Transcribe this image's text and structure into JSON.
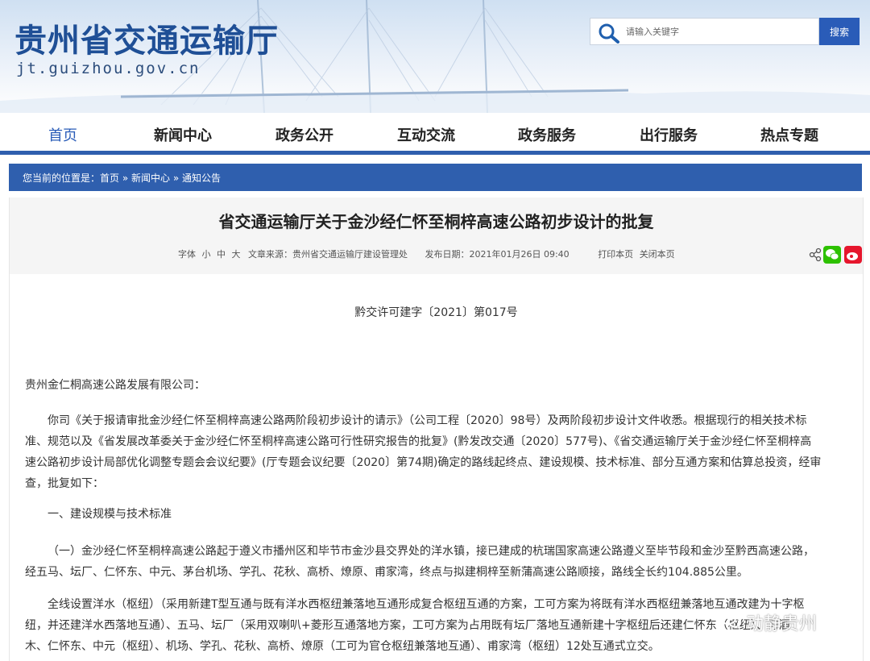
{
  "site": {
    "title": "贵州省交通运输厅",
    "url": "jt.guizhou.gov.cn"
  },
  "search": {
    "placeholder": "请输入关键字",
    "button_label": "搜索"
  },
  "nav": {
    "items": [
      {
        "label": "首页"
      },
      {
        "label": "新闻中心"
      },
      {
        "label": "政务公开"
      },
      {
        "label": "互动交流"
      },
      {
        "label": "政务服务"
      },
      {
        "label": "出行服务"
      },
      {
        "label": "热点专题"
      }
    ]
  },
  "breadcrumb": {
    "prefix": "您当前的位置是：",
    "items": [
      "首页",
      "新闻中心",
      "通知公告"
    ],
    "separator": "»"
  },
  "article": {
    "title": "省交通运输厅关于金沙经仁怀至桐梓高速公路初步设计的批复",
    "font_label": "字体",
    "size_small": "小",
    "size_medium": "中",
    "size_large": "大",
    "source": "文章来源：贵州省交通运输厅建设管理处",
    "published": "发布日期：2021年01月26日 09:40",
    "print": "打印本页",
    "close": "关闭本页",
    "doc_number": "黔交许可建字〔2021〕第017号",
    "recipient": "贵州金仁桐高速公路发展有限公司：",
    "para1": [
      "你司《关于报请审批金沙经仁怀至桐梓高速公路两阶段初步设计的请示》（公司工程〔2020〕98号）及两阶段初步设计文件收悉。根据现行的相关技术标",
      "准、规范以及《省发展改革委关于金沙经仁怀至桐梓高速公路可行性研究报告的批复》(黔发改交通〔2020〕577号)、《省交通运输厅关于金沙经仁怀至桐梓高",
      "速公路初步设计局部优化调整专题会会议纪要》(厅专题会议纪要〔2020〕第74期)确定的路线起终点、建设规模、技术标准、部分互通方案和估算总投资，经审",
      "查，批复如下："
    ],
    "section1": "一、建设规模与技术标准",
    "para2": [
      "（一）金沙经仁怀至桐梓高速公路起于遵义市播州区和毕节市金沙县交界处的洋水镇，接已建成的杭瑞国家高速公路遵义至毕节段和金沙至黔西高速公路，",
      "经五马、坛厂、仁怀东、中元、茅台机场、学孔、花秋、高桥、燎原、甫家湾，终点与拟建桐梓至新蒲高速公路顺接，路线全长约104.885公里。"
    ],
    "para3": [
      "全线设置洋水（枢纽）（采用新建T型互通与既有洋水西枢纽兼落地互通形成复合枢纽互通的方案，工可方案为将既有洋水西枢纽兼落地互通改建为十字枢",
      "纽，并还建洋水西落地互通）、五马、坛厂（采用双喇叭+菱形互通落地方案，工可方案为占用既有坛厂落地互通新建十字枢纽后还建仁怀东（枢纽）、习酒",
      "木、仁怀东、中元（枢纽）、机场、学孔、花秋、高桥、燎原（工可为官仓枢纽兼落地互通）、甫家湾（枢纽）12处互通式立交。"
    ]
  },
  "watermark": "动静贵州",
  "colors": {
    "brand_blue": "#2f5fae",
    "title_blue": "#1f4f96",
    "wechat_green": "#2dc100",
    "weibo_red": "#e6162d"
  }
}
